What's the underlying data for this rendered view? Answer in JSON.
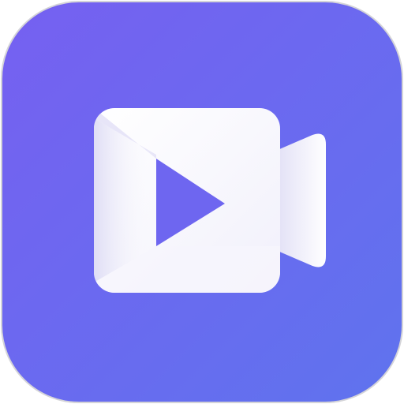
{
  "icon": {
    "name": "video-camera-play-icon",
    "colors": {
      "background_top": "#7660F1",
      "background_bottom": "#5F73EE",
      "border": "#D4D4D8",
      "glyph_light": "#FFFFFF",
      "glyph_shade": "#E4E2F7",
      "play_triangle": "#6E66F0"
    }
  }
}
